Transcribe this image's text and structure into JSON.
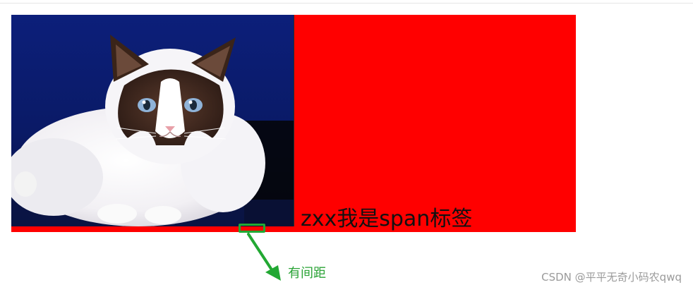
{
  "demo": {
    "span_text": "zxx我是span标签",
    "box_color": "#ff0000"
  },
  "annotation": {
    "label": "有间距",
    "color": "#2aa336"
  },
  "watermark": {
    "text": "CSDN @平平无奇小码农qwq"
  }
}
